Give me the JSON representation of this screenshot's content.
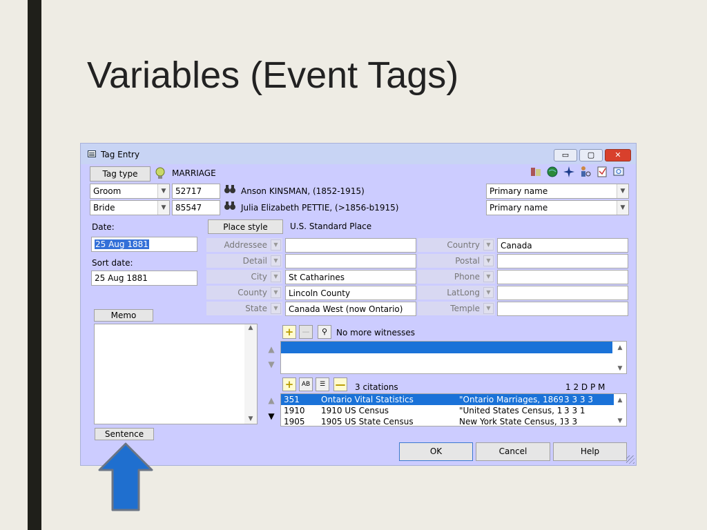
{
  "slide": {
    "title": "Variables (Event Tags)"
  },
  "window": {
    "title": "Tag Entry",
    "controls": {
      "minimize": "▭",
      "maximize": "▢",
      "close": "✕"
    }
  },
  "tag": {
    "button": "Tag type",
    "value": "MARRIAGE"
  },
  "principals": [
    {
      "role": "Groom",
      "id": "52717",
      "name": "Anson KINSMAN, (1852-1915)",
      "name_type": "Primary name"
    },
    {
      "role": "Bride",
      "id": "85547",
      "name": "Julia Elizabeth PETTIE, (>1856-b1915)",
      "name_type": "Primary name"
    }
  ],
  "date": {
    "label": "Date:",
    "value": "25 Aug 1881"
  },
  "sort_date": {
    "label": "Sort date:",
    "value": "25 Aug 1881"
  },
  "place": {
    "style_button": "Place style",
    "style_value": "U.S. Standard Place",
    "left_fields": [
      {
        "label": "Addressee",
        "value": ""
      },
      {
        "label": "Detail",
        "value": ""
      },
      {
        "label": "City",
        "value": "St Catharines"
      },
      {
        "label": "County",
        "value": "Lincoln County"
      },
      {
        "label": "State",
        "value": "Canada West (now Ontario)"
      }
    ],
    "right_fields": [
      {
        "label": "Country",
        "value": "Canada"
      },
      {
        "label": "Postal",
        "value": ""
      },
      {
        "label": "Phone",
        "value": ""
      },
      {
        "label": "LatLong",
        "value": ""
      },
      {
        "label": "Temple",
        "value": ""
      }
    ]
  },
  "memo": {
    "button": "Memo",
    "sentence_button": "Sentence"
  },
  "witnesses": {
    "status": "No more witnesses"
  },
  "citations": {
    "count_label": "3 citations",
    "columns_label": "1 2 D P M",
    "rows": [
      {
        "id": "351",
        "source": "Ontario Vital Statistics",
        "detail": "\"Ontario Marriages, 1869",
        "scores": "3 3 3 3"
      },
      {
        "id": "1910",
        "source": "1910 US Census",
        "detail": "\"United States Census, 1",
        "scores": "3 3 1"
      },
      {
        "id": "1905",
        "source": "1905 US State Census",
        "detail": "New York State Census, 1",
        "scores": "3 3"
      }
    ]
  },
  "buttons": {
    "ok": "OK",
    "cancel": "Cancel",
    "help": "Help"
  },
  "colors": {
    "window_bg": "#ccccff",
    "selection": "#1a72d8",
    "arrow": "#1f6fcf"
  }
}
